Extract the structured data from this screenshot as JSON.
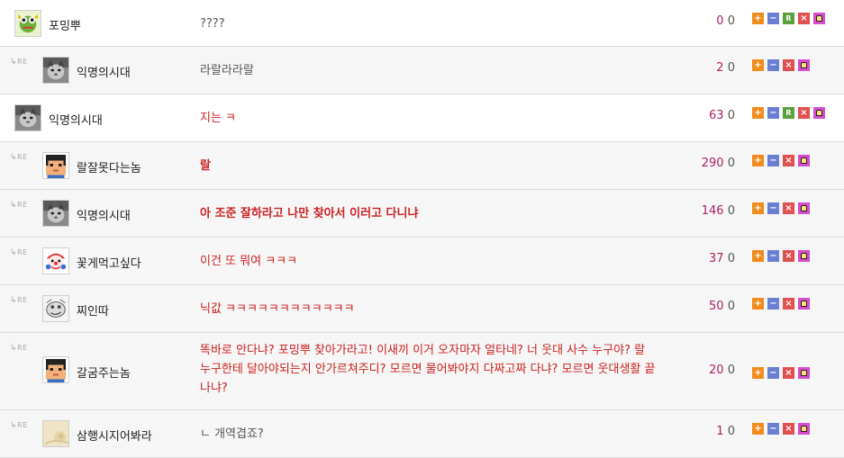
{
  "re_label": "RE",
  "comments": [
    {
      "nick": "포밍뿌",
      "avatar": "frog-avatar-icon",
      "reply": false,
      "text": "????",
      "style": "plain",
      "up": "0",
      "down": "0",
      "buttons": [
        "plus",
        "minus",
        "r",
        "x",
        "lock"
      ]
    },
    {
      "nick": "익명의시대",
      "avatar": "cat-avatar-icon",
      "reply": true,
      "text": "라랄라라랄",
      "style": "plain",
      "up": "2",
      "down": "0",
      "buttons": [
        "plus",
        "minus",
        "x",
        "lock"
      ]
    },
    {
      "nick": "익명의시대",
      "avatar": "cat-avatar-icon",
      "reply": false,
      "text": "지는 ㅋ",
      "style": "red",
      "up": "63",
      "down": "0",
      "buttons": [
        "plus",
        "minus",
        "r",
        "x",
        "lock"
      ]
    },
    {
      "nick": "랄잘못다는놈",
      "avatar": "pixel-face-avatar-icon",
      "reply": true,
      "text": "랄",
      "style": "red-bold",
      "up": "290",
      "down": "0",
      "buttons": [
        "plus",
        "minus",
        "x",
        "lock"
      ]
    },
    {
      "nick": "익명의시대",
      "avatar": "cat-avatar-icon",
      "reply": true,
      "text": "아 조준 잘하라고 나만 찾아서 이러고 다니냐",
      "style": "red-bold",
      "up": "146",
      "down": "0",
      "buttons": [
        "plus",
        "minus",
        "x",
        "lock"
      ]
    },
    {
      "nick": "꽃게먹고싶다",
      "avatar": "clown-avatar-icon",
      "reply": true,
      "text": "이건 또 뭐여 ㅋㅋㅋ",
      "style": "red",
      "up": "37",
      "down": "0",
      "buttons": [
        "plus",
        "minus",
        "x",
        "lock"
      ]
    },
    {
      "nick": "찌인따",
      "avatar": "sketch-avatar-icon",
      "reply": true,
      "text": "닉값 ㅋㅋㅋㅋㅋㅋㅋㅋㅋㅋㅋㅋ",
      "style": "red",
      "up": "50",
      "down": "0",
      "buttons": [
        "plus",
        "minus",
        "x",
        "lock"
      ]
    },
    {
      "nick": "갈굼주는놈",
      "avatar": "pixel-face-avatar-icon",
      "reply": true,
      "text": "똑바로 안다냐? 포밍뿌 찾아가라고! 이새끼 이거 오자마자 얼타네? 너 웃대 사수 누구야? 랄 누구한테 달아야되는지 안가르쳐주디? 모르면 물어봐야지 다짜고짜 다냐? 모르면 웃대생활 끝나냐?",
      "style": "red",
      "up": "20",
      "down": "0",
      "buttons": [
        "plus",
        "minus",
        "x",
        "lock"
      ]
    },
    {
      "nick": "삼행시지어봐라",
      "avatar": "beige-avatar-icon",
      "reply": true,
      "text": "ㄴ 개역겹죠?",
      "style": "plain",
      "up": "1",
      "down": "0",
      "buttons": [
        "plus",
        "minus",
        "x",
        "lock"
      ]
    }
  ]
}
